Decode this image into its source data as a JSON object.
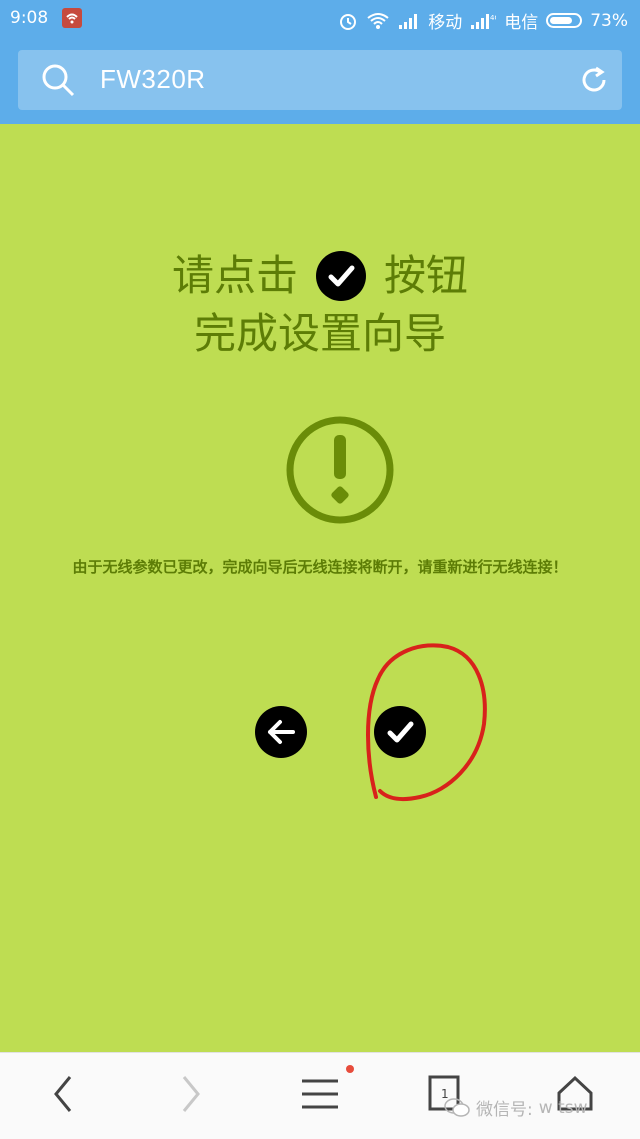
{
  "status_bar": {
    "time": "9:08",
    "carrier1": "移动",
    "carrier2": "电信",
    "battery_text": "73%",
    "battery_level": 0.73
  },
  "search": {
    "query": "FW320R"
  },
  "main": {
    "title_part1": "请点击",
    "title_part2": "按钮",
    "title_line2": "完成设置向导",
    "warning": "由于无线参数已更改，完成向导后无线连接将断开，请重新进行无线连接！"
  },
  "watermark": {
    "label": "微信号:",
    "account": "w  tsw"
  },
  "colors": {
    "background": "#bedd52",
    "header": "#5dadea",
    "text": "#5d7d06",
    "annotation": "#d8221b"
  },
  "icons": [
    "search-icon",
    "refresh-icon",
    "check-icon",
    "alert-icon",
    "back-arrow-icon",
    "chevron-left-icon",
    "chevron-right-icon",
    "menu-icon",
    "tabs-icon",
    "home-icon",
    "wechat-icon"
  ]
}
